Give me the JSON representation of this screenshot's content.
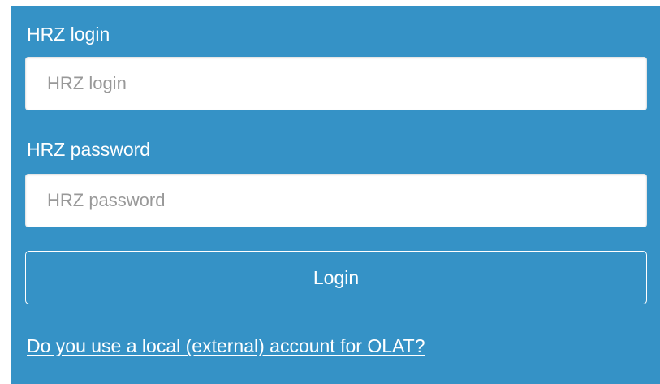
{
  "login_form": {
    "login_label": "HRZ login",
    "login_placeholder": "HRZ login",
    "login_value": "",
    "password_label": "HRZ password",
    "password_placeholder": "HRZ password",
    "password_value": "",
    "submit_label": "Login",
    "external_account_link": "Do you use a local (external) account for OLAT?"
  },
  "colors": {
    "panel_background": "#3592c6",
    "text": "#ffffff",
    "input_background": "#ffffff",
    "placeholder": "#999999"
  }
}
